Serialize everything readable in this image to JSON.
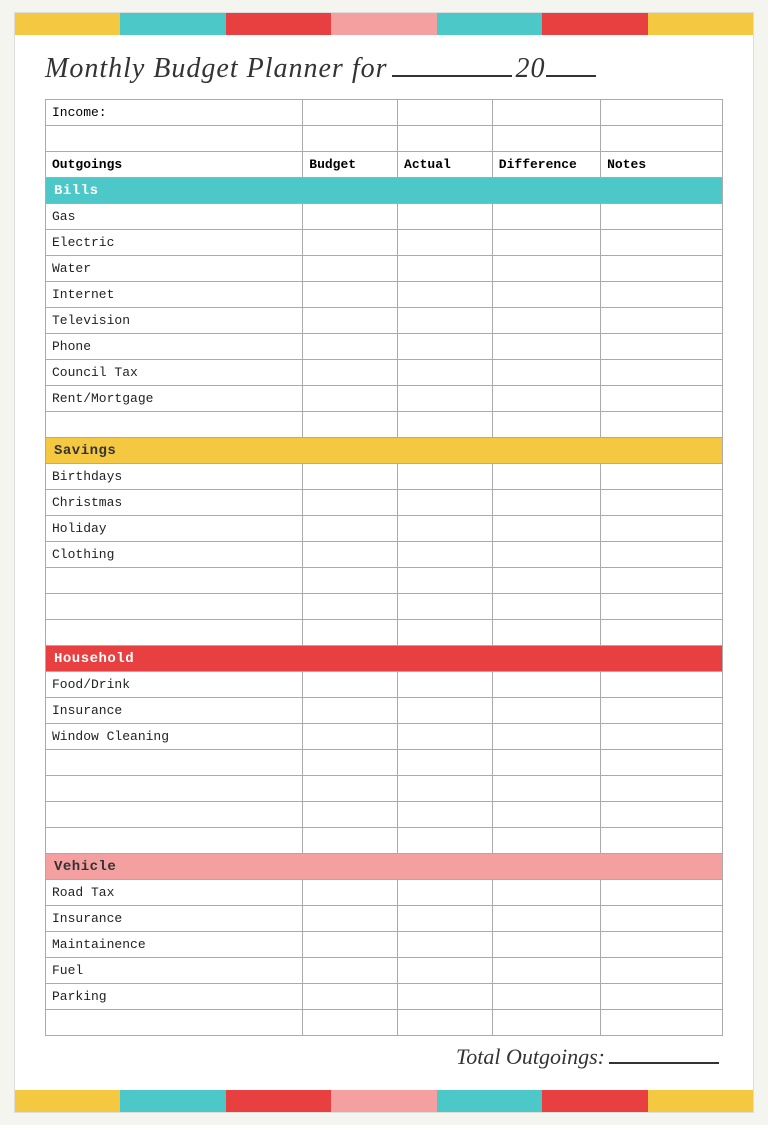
{
  "colorBars": {
    "top": [
      "yellow",
      "teal",
      "red",
      "pink",
      "teal2",
      "red2",
      "yellow2"
    ],
    "bottom": [
      "yellow",
      "teal",
      "red",
      "pink",
      "teal2",
      "red2",
      "yellow2"
    ]
  },
  "title": {
    "prefix": "Monthly Budget Planner for",
    "suffix": "20"
  },
  "incomeLabel": "Income:",
  "columns": {
    "item": "Outgoings",
    "budget": "Budget",
    "actual": "Actual",
    "difference": "Difference",
    "notes": "Notes"
  },
  "sections": [
    {
      "name": "Bills",
      "color": "teal",
      "items": [
        "Gas",
        "Electric",
        "Water",
        "Internet",
        "Television",
        "Phone",
        "Council Tax",
        "Rent/Mortgage"
      ],
      "extraEmpty": 0
    },
    {
      "name": "Savings",
      "color": "yellow",
      "items": [
        "Birthdays",
        "Christmas",
        "Holiday",
        "Clothing"
      ],
      "extraEmpty": 2
    },
    {
      "name": "Household",
      "color": "red",
      "items": [
        "Food/Drink",
        "Insurance",
        "Window Cleaning"
      ],
      "extraEmpty": 3
    },
    {
      "name": "Vehicle",
      "color": "pink",
      "items": [
        "Road Tax",
        "Insurance",
        "Maintainence",
        "Fuel",
        "Parking"
      ],
      "extraEmpty": 1
    }
  ],
  "totalLabel": "Total Outgoings:"
}
